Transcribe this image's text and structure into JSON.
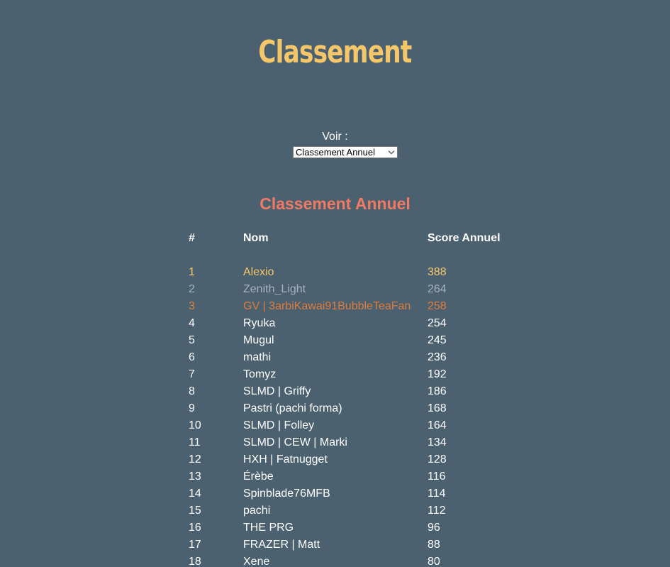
{
  "header": {
    "title": "Classement"
  },
  "view": {
    "label": "Voir :",
    "selected": "Classement Annuel"
  },
  "ranking": {
    "title": "Classement Annuel",
    "columns": [
      "#",
      "Nom",
      "Score Annuel"
    ],
    "rows": [
      {
        "rank": "1",
        "name": "Alexio",
        "score": "388"
      },
      {
        "rank": "2",
        "name": "Zenith_Light",
        "score": "264"
      },
      {
        "rank": "3",
        "name": "GV | 3arbiKawai91BubbleTeaFan",
        "score": "258"
      },
      {
        "rank": "4",
        "name": "Ryuka",
        "score": "254"
      },
      {
        "rank": "5",
        "name": "Mugul",
        "score": "245"
      },
      {
        "rank": "6",
        "name": "mathi",
        "score": "236"
      },
      {
        "rank": "7",
        "name": "Tomyz",
        "score": "192"
      },
      {
        "rank": "8",
        "name": "SLMD | Griffy",
        "score": "186"
      },
      {
        "rank": "9",
        "name": "Pastri (pachi forma)",
        "score": "168"
      },
      {
        "rank": "10",
        "name": "SLMD | Folley",
        "score": "164"
      },
      {
        "rank": "11",
        "name": "SLMD | CEW | Marki",
        "score": "134"
      },
      {
        "rank": "12",
        "name": "HXH | Fatnugget",
        "score": "128"
      },
      {
        "rank": "13",
        "name": "Érèbe",
        "score": "116"
      },
      {
        "rank": "14",
        "name": "Spinblade76MFB",
        "score": "114"
      },
      {
        "rank": "15",
        "name": "pachi",
        "score": "112"
      },
      {
        "rank": "16",
        "name": "THE PRG",
        "score": "96"
      },
      {
        "rank": "17",
        "name": "FRAZER | Matt",
        "score": "88"
      },
      {
        "rank": "18",
        "name": "Xene",
        "score": "80"
      }
    ]
  },
  "colors": {
    "background": "#4b6170",
    "title": "#f6c66b",
    "section_title": "#f07a63",
    "gold": "#f6c66b",
    "silver": "#a7b2bb",
    "bronze": "#e07b3c"
  }
}
